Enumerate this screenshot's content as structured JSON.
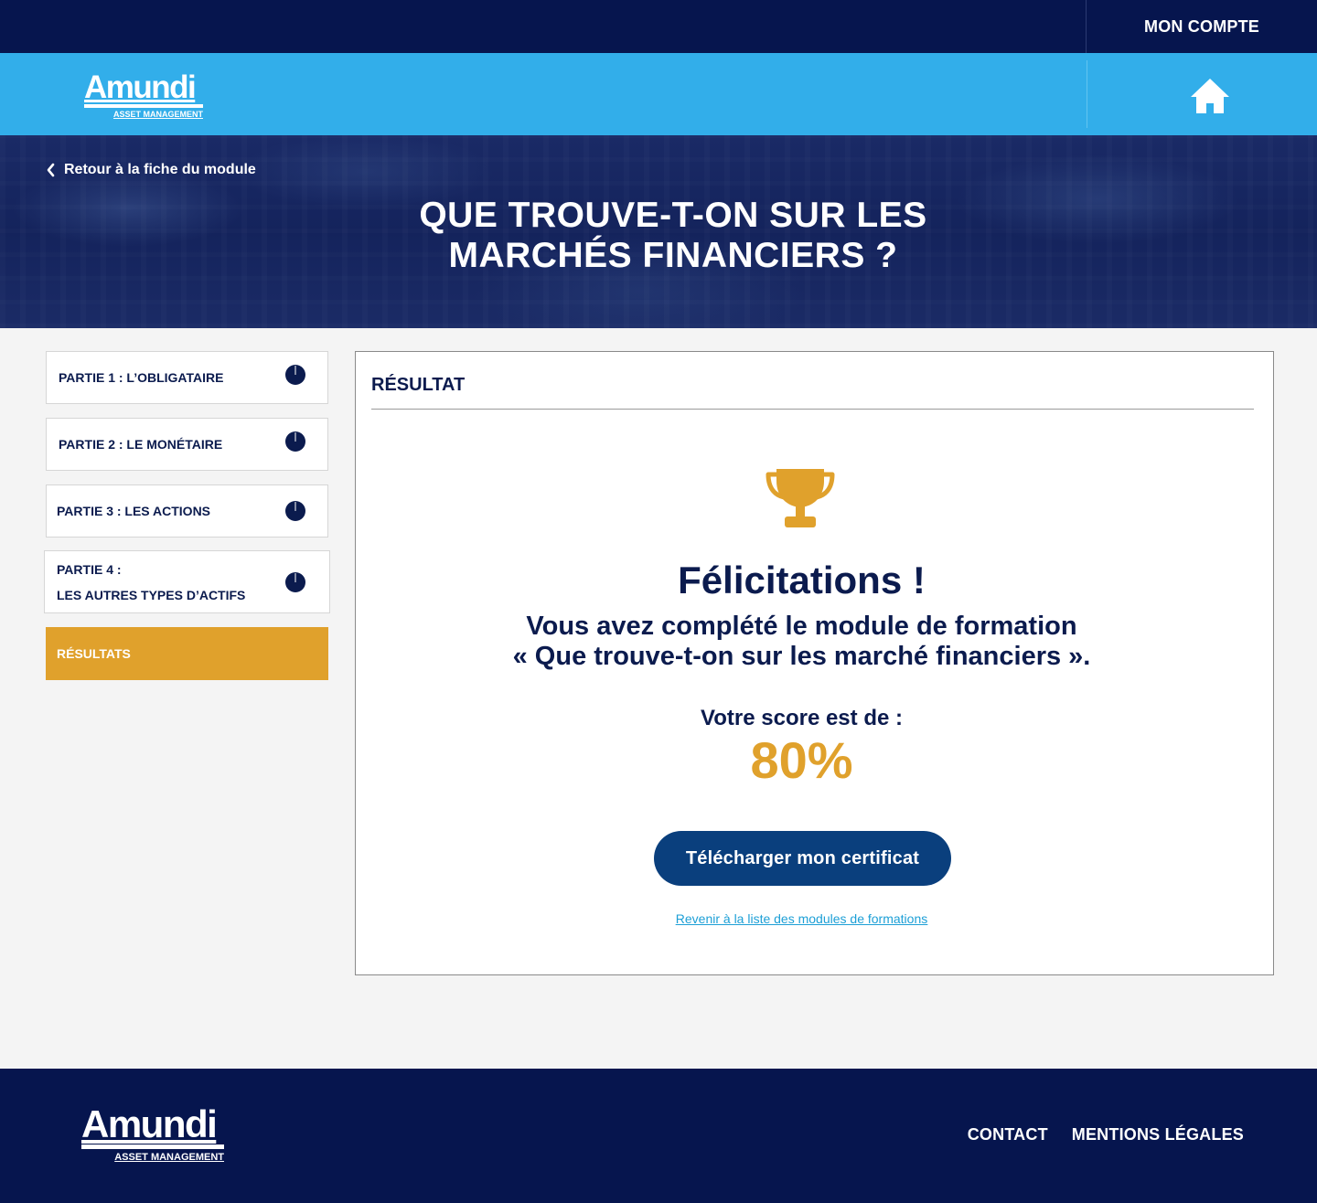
{
  "header": {
    "account_label": "MON COMPTE",
    "logo": {
      "word": "Amundi",
      "sub": "ASSET MANAGEMENT"
    },
    "home_icon": "home-icon"
  },
  "hero": {
    "back_label": "Retour à la fiche du module",
    "back_icon": "chevron-left-icon",
    "title": "QUE TROUVE-T-ON SUR LES\nMARCHÉS FINANCIERS ?"
  },
  "sidebar": {
    "items": [
      {
        "label": "PARTIE 1 : L’OBLIGATAIRE",
        "progress_icon": "progress-pie-icon"
      },
      {
        "label": "PARTIE 2 : LE MONÉTAIRE",
        "progress_icon": "progress-pie-icon"
      },
      {
        "label": "PARTIE 3 : LES ACTIONS",
        "progress_icon": "progress-pie-icon"
      },
      {
        "label": "PARTIE 4 :\nLES AUTRES TYPES D’ACTIFS",
        "progress_icon": "progress-pie-icon"
      },
      {
        "label": "RÉSULTATS",
        "active": true
      }
    ]
  },
  "result": {
    "heading": "RÉSULTAT",
    "icon": "trophy-icon",
    "congrats": "Félicitations !",
    "message": "Vous avez complété le module de formation\n« Que trouve-t-on sur les marché financiers ».",
    "score_label": "Votre score est de :",
    "score_value": "80%",
    "certificate_button": "Télécharger mon certificat",
    "modules_link": "Revenir à la liste des modules de formations"
  },
  "footer": {
    "logo": {
      "word": "Amundi",
      "sub": "ASSET MANAGEMENT"
    },
    "links": [
      "CONTACT",
      "MENTIONS LÉGALES"
    ]
  },
  "colors": {
    "navy": "#06154e",
    "sky_blue": "#32aeea",
    "gold": "#e0a12c",
    "button_blue": "#0a3f7d",
    "link_blue": "#1c9fd6"
  }
}
